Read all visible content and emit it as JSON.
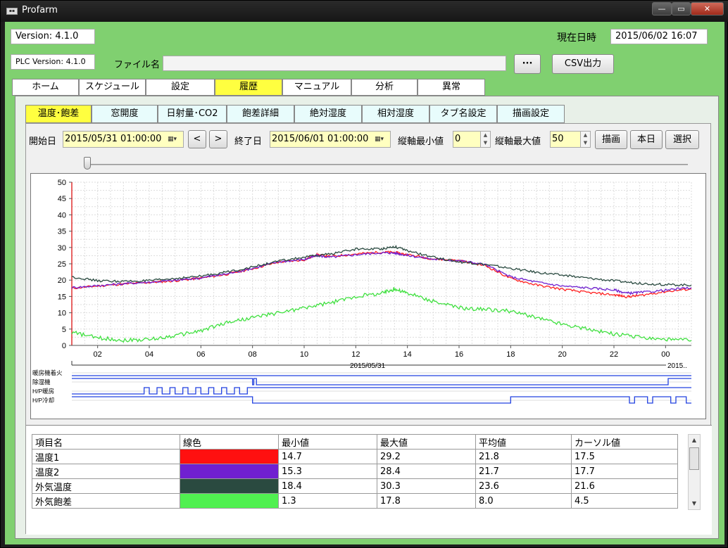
{
  "window": {
    "title": "Profarm",
    "icon": "app-icon",
    "controls": {
      "minimize": "—",
      "maximize": "▭",
      "close": "✕"
    }
  },
  "header": {
    "version": "Version: 4.1.0",
    "plc_version": "PLC Version: 4.1.0",
    "filename_label": "ファイル名",
    "filename_value": "",
    "browse_label": "···",
    "csv_label": "CSV出力",
    "datetime_label": "現在日時",
    "datetime_value": "2015/06/02 16:07"
  },
  "main_tabs": [
    {
      "label": "ホーム"
    },
    {
      "label": "スケジュール"
    },
    {
      "label": "設定"
    },
    {
      "label": "履歴"
    },
    {
      "label": "マニュアル"
    },
    {
      "label": "分析"
    },
    {
      "label": "異常"
    }
  ],
  "sub_tabs": [
    {
      "label": "温度･飽差"
    },
    {
      "label": "窓開度"
    },
    {
      "label": "日射量･CO2"
    },
    {
      "label": "飽差詳細"
    },
    {
      "label": "絶対湿度"
    },
    {
      "label": "相対湿度"
    },
    {
      "label": "タブ名設定"
    },
    {
      "label": "描画設定"
    }
  ],
  "toolbar": {
    "start_label": "開始日",
    "start_value": "2015/05/31  01:00:00",
    "prev_label": "<",
    "next_label": ">",
    "end_label": "終了日",
    "end_value": "2015/06/01  01:00:00",
    "ymin_label": "縦軸最小値",
    "ymin_value": "0",
    "ymax_label": "縦軸最大値",
    "ymax_value": "50",
    "draw_label": "描画",
    "today_label": "本日",
    "select_label": "選択"
  },
  "slider": {
    "value": 0.0
  },
  "chart_data": {
    "type": "line",
    "ylim": [
      0,
      50
    ],
    "yticks": [
      "0",
      "5",
      "10",
      "15",
      "20",
      "25",
      "30",
      "35",
      "40",
      "45",
      "50"
    ],
    "xlim": [
      1,
      25
    ],
    "xticks": [
      {
        "x": 2,
        "label": "02"
      },
      {
        "x": 4,
        "label": "04"
      },
      {
        "x": 6,
        "label": "06"
      },
      {
        "x": 8,
        "label": "08"
      },
      {
        "x": 10,
        "label": "10"
      },
      {
        "x": 12,
        "label": "12"
      },
      {
        "x": 14,
        "label": "14"
      },
      {
        "x": 16,
        "label": "16"
      },
      {
        "x": 18,
        "label": "18"
      },
      {
        "x": 20,
        "label": "20"
      },
      {
        "x": 22,
        "label": "22"
      },
      {
        "x": 24,
        "label": "00"
      }
    ],
    "date_label": "2015/05/31",
    "date_label_right": "2015..",
    "grid": true,
    "series": [
      {
        "name": "温度1",
        "color": "#ff2020",
        "x": [
          1,
          2,
          3,
          4,
          5,
          6,
          7,
          8,
          9,
          10,
          10.5,
          11,
          12,
          13,
          13.5,
          14,
          15,
          16,
          17,
          18,
          19,
          20,
          21,
          22,
          22.5,
          23,
          24,
          25
        ],
        "y": [
          17.5,
          18.2,
          18.8,
          19.3,
          19.8,
          20.6,
          21.8,
          23.5,
          25.5,
          26.2,
          27.8,
          27.2,
          28.0,
          28.6,
          28.5,
          27.8,
          26.5,
          26.0,
          24.5,
          20.5,
          18.5,
          17.2,
          16.2,
          15.5,
          14.9,
          15.3,
          16.5,
          17.3
        ]
      },
      {
        "name": "温度2",
        "color": "#7020d0",
        "x": [
          1,
          2,
          3,
          4,
          5,
          6,
          7,
          8,
          9,
          10,
          10.5,
          11,
          12,
          13,
          13.5,
          14,
          15,
          16,
          17,
          18,
          19,
          20,
          21,
          22,
          22.5,
          23,
          24,
          25
        ],
        "y": [
          17.7,
          18.3,
          18.9,
          19.4,
          19.9,
          20.7,
          21.9,
          23.6,
          25.6,
          26.3,
          27.5,
          27.0,
          27.8,
          28.4,
          28.3,
          27.6,
          26.4,
          26.0,
          24.8,
          21.0,
          19.4,
          18.2,
          17.6,
          17.0,
          16.0,
          16.2,
          16.9,
          17.7
        ]
      },
      {
        "name": "外気温度",
        "color": "#2a4a40",
        "x": [
          1,
          2,
          3,
          4,
          5,
          6,
          7,
          8,
          9,
          10,
          11,
          12,
          13,
          13.5,
          14,
          15,
          16,
          17,
          18,
          19,
          20,
          21,
          22,
          23,
          24,
          25
        ],
        "y": [
          21.0,
          19.8,
          19.6,
          19.8,
          20.5,
          21.2,
          22.5,
          24.0,
          25.8,
          27.0,
          28.0,
          29.5,
          29.6,
          30.3,
          29.0,
          27.0,
          25.6,
          24.8,
          23.6,
          22.4,
          21.5,
          20.6,
          19.8,
          19.0,
          18.6,
          18.5
        ]
      },
      {
        "name": "外気飽差",
        "color": "#40e040",
        "x": [
          1,
          2,
          3,
          4,
          5,
          6,
          7,
          8,
          9,
          10,
          11,
          12,
          13,
          13.5,
          14,
          15,
          16,
          17,
          18,
          19,
          20,
          21,
          22,
          23,
          24,
          25
        ],
        "y": [
          4.0,
          2.3,
          1.6,
          1.8,
          3.0,
          4.5,
          7.0,
          8.5,
          10.0,
          11.5,
          13.0,
          15.0,
          16.0,
          17.3,
          16.0,
          13.5,
          11.5,
          11.0,
          10.5,
          8.5,
          6.5,
          5.0,
          3.5,
          2.5,
          1.8,
          1.5
        ]
      }
    ],
    "digital_signals": [
      {
        "name": "暖房機着火",
        "x": [
          1,
          25
        ],
        "y": [
          0,
          0
        ]
      },
      {
        "name": "除湿機",
        "x": [
          1,
          8,
          8,
          8.05,
          8.05,
          8.15,
          8.15,
          24.1,
          24.1,
          25
        ],
        "y": [
          1,
          1,
          0,
          0,
          1,
          1,
          0,
          0,
          1,
          1
        ]
      },
      {
        "name": "H/P暖房",
        "x": [
          1,
          3.8,
          3.8,
          4.0,
          4.0,
          4.3,
          4.3,
          4.5,
          4.5,
          4.8,
          4.8,
          5.0,
          5.0,
          5.3,
          5.3,
          5.5,
          5.5,
          5.8,
          5.8,
          6.0,
          6.0,
          6.3,
          6.3,
          6.5,
          6.5,
          6.8,
          6.8,
          7.0,
          7.0,
          7.3,
          7.3,
          7.5,
          7.5,
          7.8,
          7.8,
          25
        ],
        "y": [
          0,
          0,
          1,
          1,
          0,
          0,
          1,
          1,
          0,
          0,
          1,
          1,
          0,
          0,
          1,
          1,
          0,
          0,
          1,
          1,
          0,
          0,
          1,
          1,
          0,
          0,
          1,
          1,
          0,
          0,
          1,
          1,
          0,
          0,
          1,
          1
        ]
      },
      {
        "name": "H/P冷却",
        "x": [
          1,
          8.0,
          8.0,
          9.5,
          9.5,
          18.0,
          18.0,
          22.6,
          22.6,
          22.8,
          22.8,
          23.3,
          23.3,
          23.5,
          23.5,
          24.2,
          24.2,
          24.4,
          24.4,
          24.8,
          24.8,
          25
        ],
        "y": [
          1,
          1,
          0,
          0,
          0,
          0,
          1,
          1,
          0,
          0,
          1,
          1,
          0,
          0,
          1,
          1,
          0,
          0,
          1,
          1,
          0,
          0
        ]
      }
    ]
  },
  "table": {
    "headers": [
      "項目名",
      "線色",
      "最小値",
      "最大値",
      "平均値",
      "カーソル値"
    ],
    "rows": [
      {
        "name": "温度1",
        "color": "#ff1010",
        "min": "14.7",
        "max": "29.2",
        "avg": "21.8",
        "cursor": "17.5"
      },
      {
        "name": "温度2",
        "color": "#7020d0",
        "min": "15.3",
        "max": "28.4",
        "avg": "21.7",
        "cursor": "17.7"
      },
      {
        "name": "外気温度",
        "color": "#2a4a40",
        "min": "18.4",
        "max": "30.3",
        "avg": "23.6",
        "cursor": "21.6"
      },
      {
        "name": "外気飽差",
        "color": "#50f050",
        "min": "1.3",
        "max": "17.8",
        "avg": "8.0",
        "cursor": "4.5"
      }
    ]
  }
}
